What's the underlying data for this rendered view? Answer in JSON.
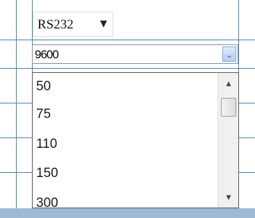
{
  "protocol": {
    "value": "RS232",
    "arrow_icon": "triangle-down-icon"
  },
  "baud_rate": {
    "value": "9600",
    "arrow_icon": "chevron-down-icon"
  },
  "dropdown": {
    "options": [
      "50",
      "75",
      "110",
      "150",
      "300"
    ],
    "scroll_up_icon": "scroll-up-arrow-icon",
    "scroll_down_icon": "scroll-down-arrow-icon"
  },
  "colors": {
    "grid_line": "#3f7fbf",
    "bottom_bar": "#9db9d4",
    "drop_button": "#b7cdf3"
  }
}
